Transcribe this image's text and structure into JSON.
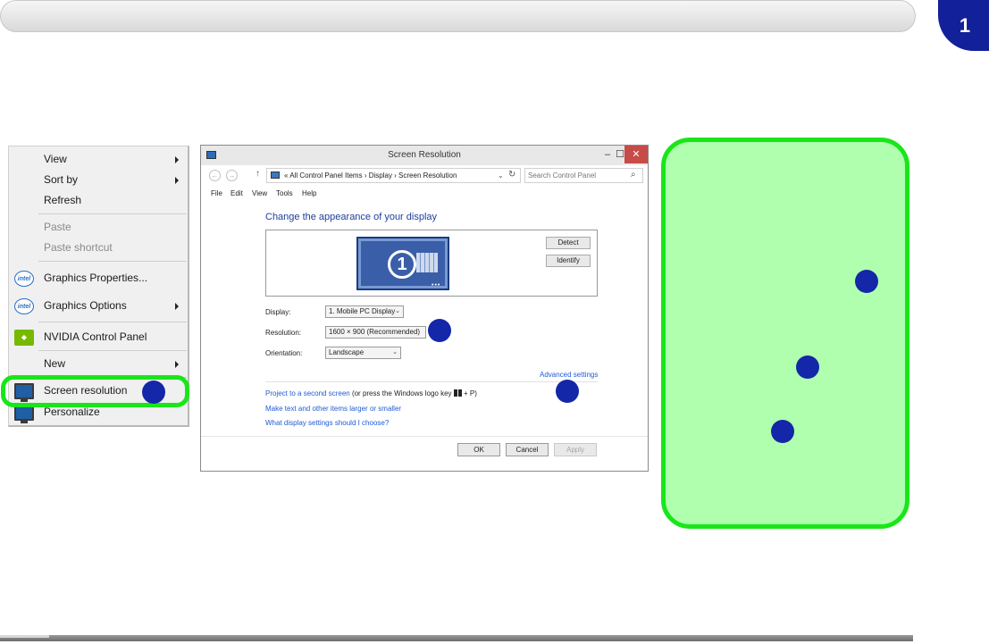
{
  "page": {
    "chapter_number": "1",
    "accent_color": "#12209a",
    "highlight_color": "#19e619",
    "callout_color": "#1327a8"
  },
  "context_menu": {
    "items": [
      {
        "label": "View",
        "submenu": true
      },
      {
        "label": "Sort by",
        "submenu": true
      },
      {
        "label": "Refresh"
      },
      {
        "label": "Paste",
        "disabled": true
      },
      {
        "label": "Paste shortcut",
        "disabled": true
      },
      {
        "label": "Graphics Properties...",
        "icon": "intel-icon"
      },
      {
        "label": "Graphics Options",
        "icon": "intel-icon",
        "submenu": true
      },
      {
        "label": "NVIDIA Control Panel",
        "icon": "nvidia-icon"
      },
      {
        "label": "New",
        "submenu": true
      },
      {
        "label": "Screen resolution",
        "icon": "screen-resolution-icon",
        "highlighted": true
      },
      {
        "label": "Personalize",
        "icon": "personalize-icon"
      }
    ],
    "intel_icon_text": "intel",
    "nvidia_icon_text": "◆"
  },
  "window": {
    "title": "Screen Resolution",
    "controls": {
      "minimize": "–",
      "maximize": "☐",
      "close": "✕"
    },
    "nav": {
      "back": "←",
      "forward": "→",
      "up": "↑",
      "dropdown": "⌄",
      "refresh": "↻"
    },
    "address": "«  All Control Panel Items  ›  Display  ›  Screen Resolution",
    "search_placeholder": "Search Control Panel",
    "search_icon": "⌕",
    "menu": [
      "File",
      "Edit",
      "View",
      "Tools",
      "Help"
    ],
    "heading": "Change the appearance of your display",
    "monitor_number": "1",
    "monitor_dots": "•••",
    "detect_label": "Detect",
    "identify_label": "Identify",
    "display_label": "Display:",
    "display_value": "1. Mobile PC Display",
    "resolution_label": "Resolution:",
    "resolution_value": "1600 × 900 (Recommended)",
    "orientation_label": "Orientation:",
    "orientation_value": "Landscape",
    "dropdown_glyph": "⌄",
    "advanced_settings": "Advanced settings",
    "project_link": "Project to a second screen",
    "project_suffix_before": " (or press the Windows logo key ",
    "project_suffix_after": " + P)",
    "text_size_link": "Make text and other items larger or smaller",
    "choose_link": "What display settings should I choose?",
    "ok_label": "OK",
    "cancel_label": "Cancel",
    "apply_label": "Apply"
  }
}
